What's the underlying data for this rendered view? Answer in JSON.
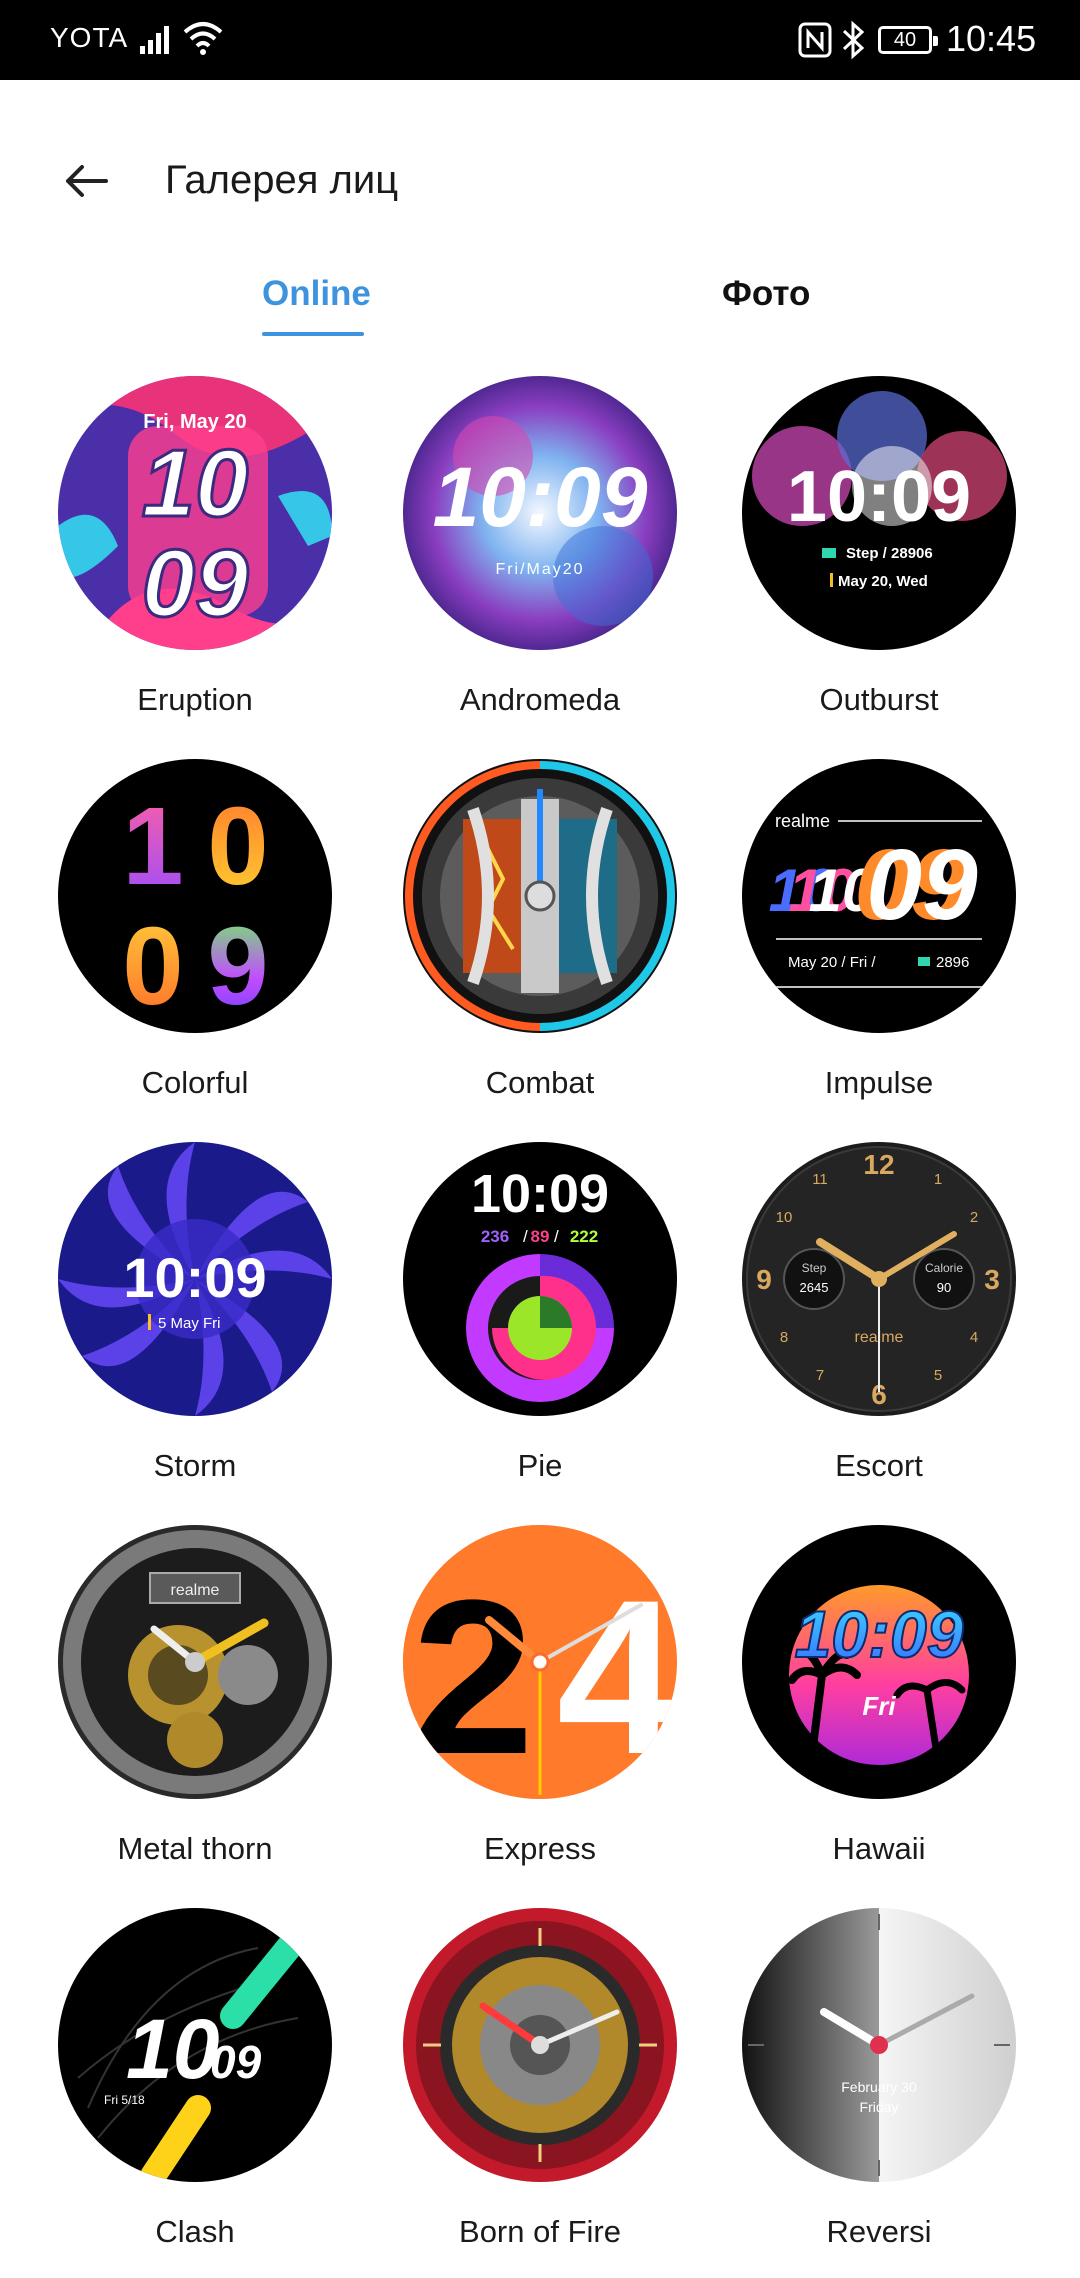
{
  "status_bar": {
    "carrier": "YOTA",
    "battery": "40",
    "time": "10:45"
  },
  "header": {
    "title": "Галерея лиц"
  },
  "tabs": [
    {
      "label": "Online",
      "active": true
    },
    {
      "label": "Фото",
      "active": false
    }
  ],
  "faces": [
    {
      "name": "Eruption",
      "texts": [
        "Fri, May 20",
        "10",
        "09"
      ]
    },
    {
      "name": "Andromeda",
      "texts": [
        "10:09",
        "Fri/May20"
      ]
    },
    {
      "name": "Outburst",
      "texts": [
        "10:09",
        "Step / 28906",
        "May 20, Wed"
      ]
    },
    {
      "name": "Colorful",
      "texts": [
        "1",
        "0",
        "0",
        "9"
      ]
    },
    {
      "name": "Combat",
      "texts": []
    },
    {
      "name": "Impulse",
      "texts": [
        "realme",
        "10",
        "09",
        "May 20  /  Fri  /",
        "2896"
      ]
    },
    {
      "name": "Storm",
      "texts": [
        "10:09",
        "5 May Fri"
      ]
    },
    {
      "name": "Pie",
      "texts": [
        "10:09",
        "236",
        "89",
        "222"
      ]
    },
    {
      "name": "Escort",
      "texts": [
        "12",
        "3",
        "6",
        "9",
        "Step",
        "2645",
        "Calorie",
        "90",
        "realme"
      ]
    },
    {
      "name": "Metal thorn",
      "texts": [
        "realme"
      ]
    },
    {
      "name": "Express",
      "texts": [
        "2",
        "4"
      ]
    },
    {
      "name": "Hawaii",
      "texts": [
        "10:09",
        "Fri"
      ]
    },
    {
      "name": "Clash",
      "texts": [
        "10",
        "09",
        "Fri  5/18"
      ]
    },
    {
      "name": "Born of Fire",
      "texts": []
    },
    {
      "name": "Reversi",
      "texts": [
        "February 30",
        "Friday"
      ]
    }
  ]
}
